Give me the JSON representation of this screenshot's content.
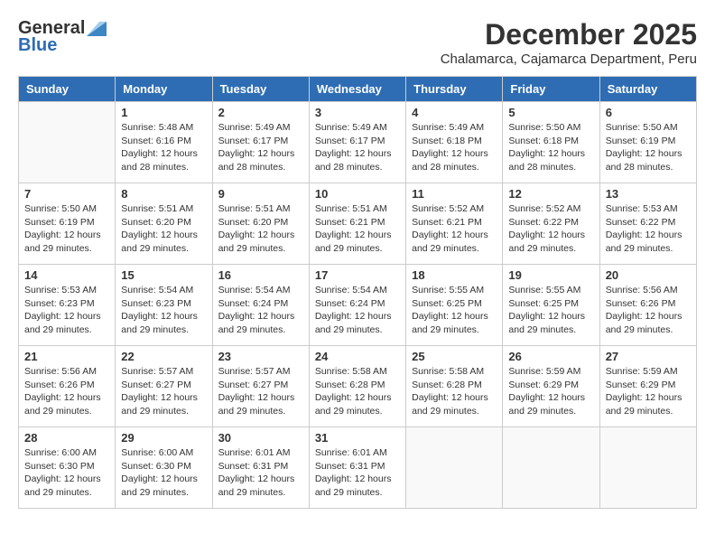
{
  "logo": {
    "general": "General",
    "blue": "Blue"
  },
  "title": "December 2025",
  "subtitle": "Chalamarca, Cajamarca Department, Peru",
  "days_of_week": [
    "Sunday",
    "Monday",
    "Tuesday",
    "Wednesday",
    "Thursday",
    "Friday",
    "Saturday"
  ],
  "weeks": [
    [
      {
        "day": "",
        "info": ""
      },
      {
        "day": "1",
        "info": "Sunrise: 5:48 AM\nSunset: 6:16 PM\nDaylight: 12 hours\nand 28 minutes."
      },
      {
        "day": "2",
        "info": "Sunrise: 5:49 AM\nSunset: 6:17 PM\nDaylight: 12 hours\nand 28 minutes."
      },
      {
        "day": "3",
        "info": "Sunrise: 5:49 AM\nSunset: 6:17 PM\nDaylight: 12 hours\nand 28 minutes."
      },
      {
        "day": "4",
        "info": "Sunrise: 5:49 AM\nSunset: 6:18 PM\nDaylight: 12 hours\nand 28 minutes."
      },
      {
        "day": "5",
        "info": "Sunrise: 5:50 AM\nSunset: 6:18 PM\nDaylight: 12 hours\nand 28 minutes."
      },
      {
        "day": "6",
        "info": "Sunrise: 5:50 AM\nSunset: 6:19 PM\nDaylight: 12 hours\nand 28 minutes."
      }
    ],
    [
      {
        "day": "7",
        "info": "Sunrise: 5:50 AM\nSunset: 6:19 PM\nDaylight: 12 hours\nand 29 minutes."
      },
      {
        "day": "8",
        "info": "Sunrise: 5:51 AM\nSunset: 6:20 PM\nDaylight: 12 hours\nand 29 minutes."
      },
      {
        "day": "9",
        "info": "Sunrise: 5:51 AM\nSunset: 6:20 PM\nDaylight: 12 hours\nand 29 minutes."
      },
      {
        "day": "10",
        "info": "Sunrise: 5:51 AM\nSunset: 6:21 PM\nDaylight: 12 hours\nand 29 minutes."
      },
      {
        "day": "11",
        "info": "Sunrise: 5:52 AM\nSunset: 6:21 PM\nDaylight: 12 hours\nand 29 minutes."
      },
      {
        "day": "12",
        "info": "Sunrise: 5:52 AM\nSunset: 6:22 PM\nDaylight: 12 hours\nand 29 minutes."
      },
      {
        "day": "13",
        "info": "Sunrise: 5:53 AM\nSunset: 6:22 PM\nDaylight: 12 hours\nand 29 minutes."
      }
    ],
    [
      {
        "day": "14",
        "info": "Sunrise: 5:53 AM\nSunset: 6:23 PM\nDaylight: 12 hours\nand 29 minutes."
      },
      {
        "day": "15",
        "info": "Sunrise: 5:54 AM\nSunset: 6:23 PM\nDaylight: 12 hours\nand 29 minutes."
      },
      {
        "day": "16",
        "info": "Sunrise: 5:54 AM\nSunset: 6:24 PM\nDaylight: 12 hours\nand 29 minutes."
      },
      {
        "day": "17",
        "info": "Sunrise: 5:54 AM\nSunset: 6:24 PM\nDaylight: 12 hours\nand 29 minutes."
      },
      {
        "day": "18",
        "info": "Sunrise: 5:55 AM\nSunset: 6:25 PM\nDaylight: 12 hours\nand 29 minutes."
      },
      {
        "day": "19",
        "info": "Sunrise: 5:55 AM\nSunset: 6:25 PM\nDaylight: 12 hours\nand 29 minutes."
      },
      {
        "day": "20",
        "info": "Sunrise: 5:56 AM\nSunset: 6:26 PM\nDaylight: 12 hours\nand 29 minutes."
      }
    ],
    [
      {
        "day": "21",
        "info": "Sunrise: 5:56 AM\nSunset: 6:26 PM\nDaylight: 12 hours\nand 29 minutes."
      },
      {
        "day": "22",
        "info": "Sunrise: 5:57 AM\nSunset: 6:27 PM\nDaylight: 12 hours\nand 29 minutes."
      },
      {
        "day": "23",
        "info": "Sunrise: 5:57 AM\nSunset: 6:27 PM\nDaylight: 12 hours\nand 29 minutes."
      },
      {
        "day": "24",
        "info": "Sunrise: 5:58 AM\nSunset: 6:28 PM\nDaylight: 12 hours\nand 29 minutes."
      },
      {
        "day": "25",
        "info": "Sunrise: 5:58 AM\nSunset: 6:28 PM\nDaylight: 12 hours\nand 29 minutes."
      },
      {
        "day": "26",
        "info": "Sunrise: 5:59 AM\nSunset: 6:29 PM\nDaylight: 12 hours\nand 29 minutes."
      },
      {
        "day": "27",
        "info": "Sunrise: 5:59 AM\nSunset: 6:29 PM\nDaylight: 12 hours\nand 29 minutes."
      }
    ],
    [
      {
        "day": "28",
        "info": "Sunrise: 6:00 AM\nSunset: 6:30 PM\nDaylight: 12 hours\nand 29 minutes."
      },
      {
        "day": "29",
        "info": "Sunrise: 6:00 AM\nSunset: 6:30 PM\nDaylight: 12 hours\nand 29 minutes."
      },
      {
        "day": "30",
        "info": "Sunrise: 6:01 AM\nSunset: 6:31 PM\nDaylight: 12 hours\nand 29 minutes."
      },
      {
        "day": "31",
        "info": "Sunrise: 6:01 AM\nSunset: 6:31 PM\nDaylight: 12 hours\nand 29 minutes."
      },
      {
        "day": "",
        "info": ""
      },
      {
        "day": "",
        "info": ""
      },
      {
        "day": "",
        "info": ""
      }
    ]
  ]
}
